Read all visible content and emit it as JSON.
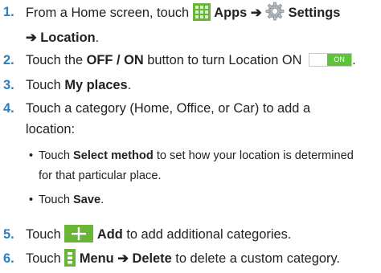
{
  "steps": [
    {
      "number": "1.",
      "t1": "From a Home screen, touch",
      "icon1": "apps-grid-icon",
      "b1": "Apps",
      "arrow1": "➔",
      "icon2": "settings-gear-icon",
      "b2": "Settings",
      "arrow2": "➔",
      "b3": "Location",
      "end": "."
    },
    {
      "number": "2.",
      "t1": "Touch the",
      "b1": "OFF / ON",
      "t2": "button to turn Location ON",
      "toggle_label": "ON",
      "end": "."
    },
    {
      "number": "3.",
      "t1": "Touch",
      "b1": "My places",
      "end": "."
    },
    {
      "number": "4.",
      "t1": "Touch a category (Home, Office, or Car) to add a",
      "t2": "location:"
    },
    {
      "number": "5.",
      "t1": "Touch",
      "icon": "add-plus-icon",
      "b1": "Add",
      "t2": "to add additional categories."
    },
    {
      "number": "6.",
      "t1": "Touch",
      "icon": "menu-icon",
      "b1": "Menu",
      "arrow": "➔",
      "b2": "Delete",
      "t2": "to delete a custom category."
    }
  ],
  "substeps": [
    {
      "bullet": "•",
      "t1": "Touch",
      "b1": "Select method",
      "t2": "to set how your location is determined",
      "t3": "for that particular place."
    },
    {
      "bullet": "•",
      "t1": "Touch",
      "b1": "Save",
      "end": "."
    }
  ],
  "colors": {
    "step_number": "#2a7fc0",
    "icon_green": "#69b538",
    "toggle_on": "#5cc33b"
  }
}
